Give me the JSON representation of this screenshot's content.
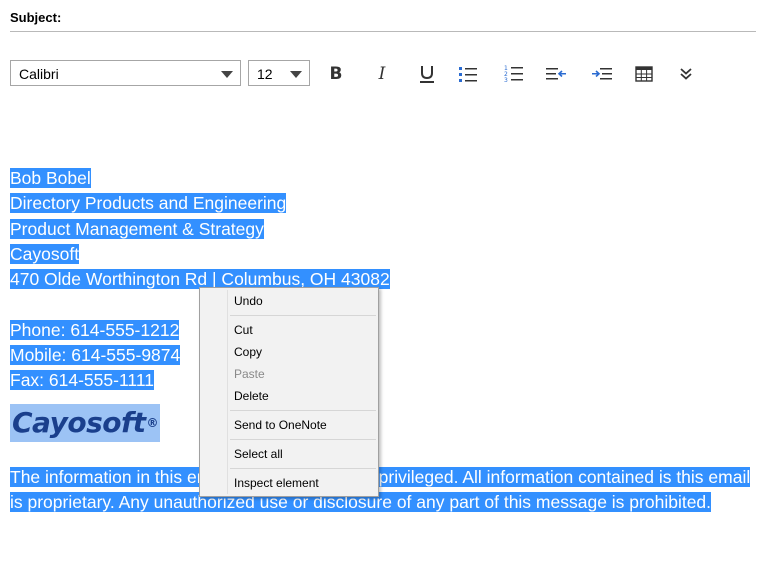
{
  "compose": {
    "subject_label": "Subject:",
    "subject_value": ""
  },
  "toolbar": {
    "font_family": "Calibri",
    "font_size": "12",
    "icons": [
      "bold-icon",
      "italic-icon",
      "underline-icon",
      "bulleted-list-icon",
      "numbered-list-icon",
      "decrease-indent-icon",
      "increase-indent-icon",
      "table-icon",
      "more-options-icon"
    ]
  },
  "signature": {
    "name": "Bob Bobel",
    "title": "Directory Products and Engineering",
    "department": "Product Management & Strategy",
    "company": "Cayosoft",
    "address": "470 Olde Worthington Rd | Columbus, OH 43082",
    "phone": "Phone: 614-555-1212",
    "mobile": "Mobile: 614-555-9874",
    "fax": "Fax: 614-555-1111",
    "logo_text": "Cayosoft",
    "logo_mark": "®",
    "disclaimer": "The information in this email is confidential and privileged. All information contained is this email is proprietary. Any unauthorized use or disclosure of any part of this message is prohibited."
  },
  "context_menu": {
    "items": [
      {
        "label": "Undo",
        "enabled": true
      },
      {
        "label": "Cut",
        "enabled": true
      },
      {
        "label": "Copy",
        "enabled": true
      },
      {
        "label": "Paste",
        "enabled": false
      },
      {
        "label": "Delete",
        "enabled": true
      },
      {
        "label": "Send to OneNote",
        "enabled": true
      },
      {
        "label": "Select all",
        "enabled": true
      },
      {
        "label": "Inspect element",
        "enabled": true
      }
    ]
  },
  "colors": {
    "selection": "#3390ff",
    "logo_text": "#1a3f8c",
    "menu_bg": "#f2f2f2"
  }
}
